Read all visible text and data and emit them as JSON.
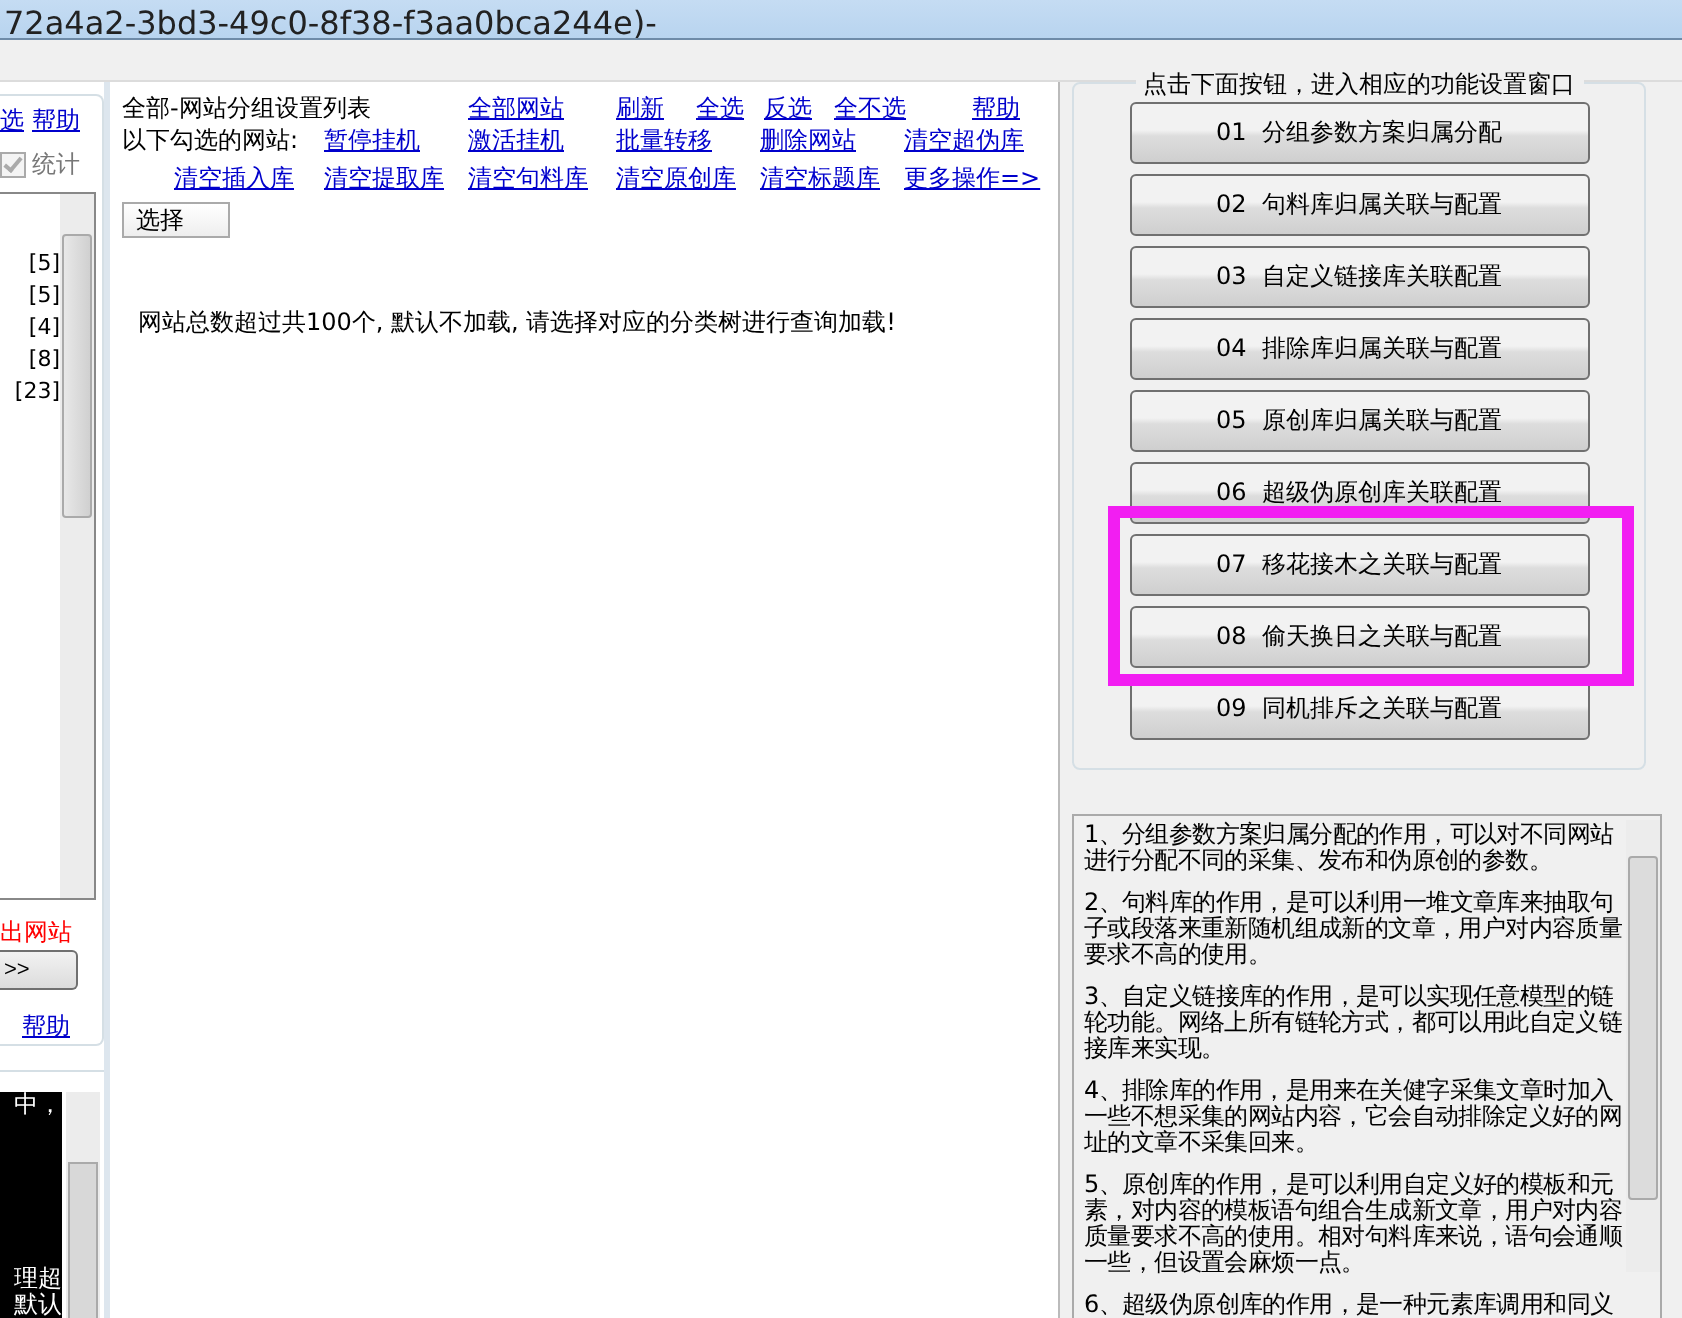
{
  "window": {
    "title": "72a4a2-3bd3-49c0-8f38-f3aa0bca244e)-"
  },
  "left_panel": {
    "links": [
      "选",
      "帮助"
    ],
    "stats_checkbox": {
      "label": "统计",
      "checked": true,
      "disabled": true
    },
    "list_items": [
      "[5]",
      "[5]",
      "[4]",
      "[8]",
      "[23]"
    ],
    "remove_label": "出网站",
    "move_button": ">>",
    "help_link": "帮助",
    "console_lines": [
      "中，",
      "理超",
      "默认"
    ]
  },
  "middle_panel": {
    "title": "全部-网站分组设置列表",
    "header_links": [
      "全部网站",
      "刷新",
      "全选",
      "反选",
      "全不选",
      "帮助"
    ],
    "selection_label": "以下勾选的网站:",
    "actions": [
      "暂停挂机",
      "激活挂机",
      "批量转移",
      "删除网站",
      "清空超伪库",
      "清空插入库",
      "清空提取库",
      "清空句料库",
      "清空原创库",
      "清空标题库",
      "更多操作=>"
    ],
    "select_dropdown": "选择",
    "message": "网站总数超过共100个, 默认不加载, 请选择对应的分类树进行查询加载!"
  },
  "right_panel": {
    "group_title": "点击下面按钮，进入相应的功能设置窗口",
    "buttons": [
      {
        "kind": "button",
        "number": "01",
        "label": "分组参数方案归属分配"
      },
      {
        "kind": "button",
        "number": "02",
        "label": "句料库归属关联与配置"
      },
      {
        "kind": "button",
        "number": "03",
        "label": "自定义链接库关联配置"
      },
      {
        "kind": "button",
        "number": "04",
        "label": "排除库归属关联与配置"
      },
      {
        "kind": "button",
        "number": "05",
        "label": "原创库归属关联与配置"
      },
      {
        "kind": "button",
        "number": "06",
        "label": "超级伪原创库关联配置"
      },
      {
        "kind": "highlight_box",
        "color": "#f21ef2",
        "buttons": [
          {
            "number": "07",
            "label": "移花接木之关联与配置"
          },
          {
            "number": "08",
            "label": "偷天换日之关联与配置"
          }
        ]
      },
      {
        "kind": "button",
        "number": "09",
        "label": "同机排斥之关联与配置"
      }
    ],
    "descriptions": [
      "1、分组参数方案归属分配的作用，可以对不同网站进行分配不同的采集、发布和伪原创的参数。",
      "2、句料库的作用，是可以利用一堆文章库来抽取句子或段落来重新随机组成新的文章，用户对内容质量要求不高的使用。",
      "3、自定义链接库的作用，是可以实现任意模型的链轮功能。网络上所有链轮方式，都可以用此自定义链接库来实现。",
      "4、排除库的作用，是用来在关健字采集文章时加入一些不想采集的网站内容，它会自动排除定义好的网址的文章不采集回来。",
      "5、原创库的作用，是可以利用自定义好的模板和元素，对内容的模板语句组合生成新文章，用户对内容质量要求不高的使用。相对句料库来说，语句会通顺一些，但设置会麻烦一点。",
      "6、超级伪原创库的作用，是一种元素库调用和同义"
    ]
  }
}
